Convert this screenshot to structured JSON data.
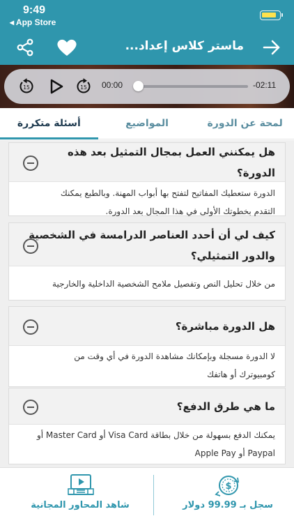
{
  "status_bar": {
    "time": "9:49",
    "back_label": "◂ App Store"
  },
  "header": {
    "title": "ماستر كلاس إعداد..."
  },
  "player": {
    "current_time": "00:00",
    "remaining_time": "-02:11",
    "progress": 0
  },
  "tabs": [
    {
      "label": "لمحة عن الدورة",
      "active": false
    },
    {
      "label": "المواضيع",
      "active": false
    },
    {
      "label": "أسئلة متكررة",
      "active": true
    }
  ],
  "faq": [
    {
      "question_lines": [
        "هل يمكنني العمل بمجال التمثيل بعد هذه",
        "الدورة؟"
      ],
      "answer_lines": [
        "الدورة ستعطيك المفاتيح لتفتح بها أبواب المهنة. وبالطبع يمكنك",
        "التقدم بخطوتك الأولى في هذا المجال بعد الدورة."
      ]
    },
    {
      "question_lines": [
        "كيف لي أن أحدد العناصر الدرامسة في الشخصية",
        "والدور التمثيلي؟"
      ],
      "answer_lines": [
        "من خلال تحليل النص وتفصيل ملامح الشخصية الداخلية والخارجية"
      ]
    },
    {
      "question_lines": [
        "هل الدورة مباشرة؟"
      ],
      "answer_lines": [
        "لا الدورة مسجلة وبإمكانك مشاهدة الدورة في أي وقت من",
        "كومبيوترك أو هاتفك"
      ]
    },
    {
      "question_lines": [
        "ما هي طرق الدفع؟"
      ],
      "answer_lines": [
        "يمكنك الدفع بسهولة من خلال بطاقة Visa Card أو Master Card أو",
        "Paypal أو Apple Pay"
      ]
    }
  ],
  "bottom_bar": {
    "free_label": "شاهد المحاور المجانية",
    "buy_label": "سجل بـ 99.99 دولار"
  },
  "colors": {
    "primary": "#2f96ad",
    "tab_active": "#1e3a4f",
    "battery": "#ffe14d"
  },
  "icons": [
    "share-icon",
    "heart-icon",
    "arrow-right-icon",
    "rewind-15-icon",
    "play-icon",
    "forward-15-icon",
    "minus-circle-icon",
    "video-tutorial-icon",
    "dollar-clock-icon"
  ]
}
